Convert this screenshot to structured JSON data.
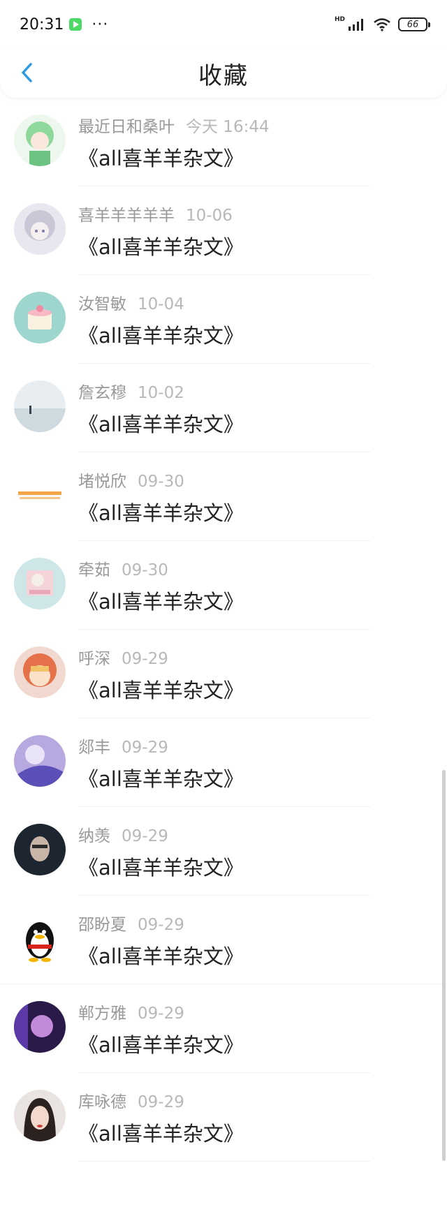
{
  "status_bar": {
    "time": "20:31",
    "more": "···",
    "hd": "HD",
    "battery": "66"
  },
  "header": {
    "title": "收藏"
  },
  "items": [
    {
      "name": "最近日和桑叶",
      "time": "今天 16:44",
      "title": "《all喜羊羊杂文》"
    },
    {
      "name": "喜羊羊羊羊羊",
      "time": "10-06",
      "title": "《all喜羊羊杂文》"
    },
    {
      "name": "汝智敏",
      "time": "10-04",
      "title": "《all喜羊羊杂文》"
    },
    {
      "name": "詹玄穆",
      "time": "10-02",
      "title": "《all喜羊羊杂文》"
    },
    {
      "name": "堵悦欣",
      "time": "09-30",
      "title": "《all喜羊羊杂文》"
    },
    {
      "name": "牵茹",
      "time": "09-30",
      "title": "《all喜羊羊杂文》"
    },
    {
      "name": "呼深",
      "time": "09-29",
      "title": "《all喜羊羊杂文》"
    },
    {
      "name": "郯丰",
      "time": "09-29",
      "title": "《all喜羊羊杂文》"
    },
    {
      "name": "纳羡",
      "time": "09-29",
      "title": "《all喜羊羊杂文》"
    },
    {
      "name": "邵盼夏",
      "time": "09-29",
      "title": "《all喜羊羊杂文》"
    },
    {
      "name": "郸方雅",
      "time": "09-29",
      "title": "《all喜羊羊杂文》"
    },
    {
      "name": "库咏德",
      "time": "09-29",
      "title": "《all喜羊羊杂文》"
    }
  ],
  "colors": {
    "accent": "#2b9be6",
    "meta_text": "#999999",
    "title_text": "#222222"
  },
  "icons": {
    "back": "chevron-left-icon"
  }
}
